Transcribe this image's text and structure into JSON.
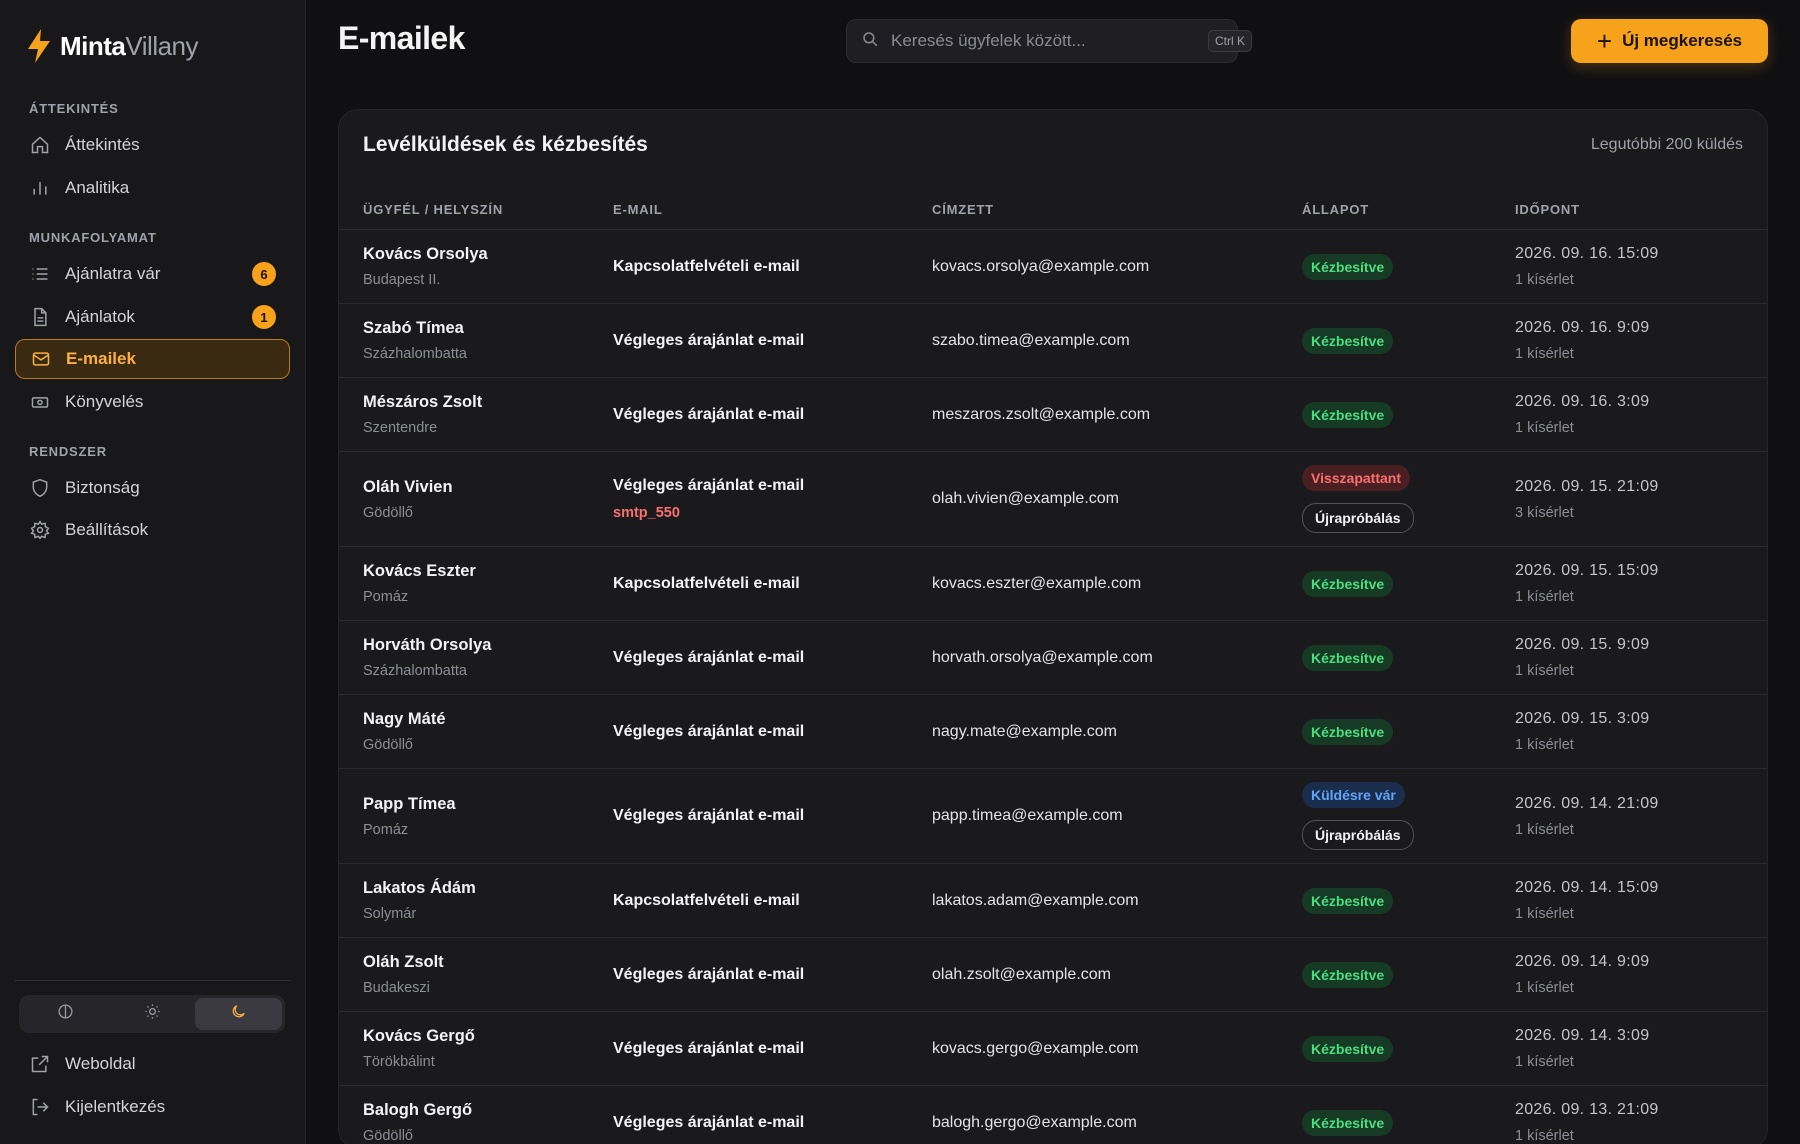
{
  "brand": {
    "part1": "Minta",
    "part2": "Villany",
    "accent": "#f7a21b"
  },
  "sidebar": {
    "sections": [
      {
        "label": "ÁTTEKINTÉS"
      },
      {
        "label": "MUNKAFOLYAMAT"
      },
      {
        "label": "RENDSZER"
      }
    ],
    "items": [
      {
        "label": "Áttekintés",
        "icon": "home-icon"
      },
      {
        "label": "Analitika",
        "icon": "bar-chart-icon"
      },
      {
        "label": "Ajánlatra vár",
        "icon": "list-icon",
        "count": "6"
      },
      {
        "label": "Ajánlatok",
        "icon": "document-icon",
        "count": "1"
      },
      {
        "label": "E-mailek",
        "icon": "mail-icon",
        "active": true
      },
      {
        "label": "Könyvelés",
        "icon": "banknote-icon"
      },
      {
        "label": "Biztonság",
        "icon": "shield-icon"
      },
      {
        "label": "Beállítások",
        "icon": "gear-icon"
      }
    ],
    "theme_options": [
      "contrast-icon",
      "sun-icon",
      "moon-icon"
    ],
    "theme_active": "moon-icon",
    "footer": [
      {
        "label": "Weboldal",
        "icon": "external-link-icon"
      },
      {
        "label": "Kijelentkezés",
        "icon": "logout-icon"
      }
    ]
  },
  "header": {
    "title": "E-mailek",
    "search_placeholder": "Keresés ügyfelek között...",
    "search_shortcut": "Ctrl K",
    "new_button": "Új megkeresés"
  },
  "card": {
    "title": "Levélküldések és kézbesítés",
    "meta": "Legutóbbi 200 küldés",
    "columns": [
      "ÜGYFÉL / HELYSZÍN",
      "E-MAIL",
      "CÍMZETT",
      "ÁLLAPOT",
      "IDŐPONT"
    ],
    "retry_label": "Újrapróbálás",
    "rows": [
      {
        "name": "Kovács Orsolya",
        "place": "Budapest II.",
        "subject": "Kapcsolatfelvételi e-mail",
        "recipient": "kovacs.orsolya@example.com",
        "status": "Kézbesítve",
        "status_type": "ok",
        "date": "2026. 09. 16. 15:09",
        "tries": "1 kísérlet"
      },
      {
        "name": "Szabó Tímea",
        "place": "Százhalombatta",
        "subject": "Végleges árajánlat e-mail",
        "recipient": "szabo.timea@example.com",
        "status": "Kézbesítve",
        "status_type": "ok",
        "date": "2026. 09. 16. 9:09",
        "tries": "1 kísérlet"
      },
      {
        "name": "Mészáros Zsolt",
        "place": "Szentendre",
        "subject": "Végleges árajánlat e-mail",
        "recipient": "meszaros.zsolt@example.com",
        "status": "Kézbesítve",
        "status_type": "ok",
        "date": "2026. 09. 16. 3:09",
        "tries": "1 kísérlet"
      },
      {
        "name": "Oláh Vivien",
        "place": "Gödöllő",
        "subject": "Végleges árajánlat e-mail",
        "error": "smtp_550",
        "recipient": "olah.vivien@example.com",
        "status": "Visszapattant",
        "status_type": "bounce",
        "retry": true,
        "date": "2026. 09. 15. 21:09",
        "tries": "3 kísérlet"
      },
      {
        "name": "Kovács Eszter",
        "place": "Pomáz",
        "subject": "Kapcsolatfelvételi e-mail",
        "recipient": "kovacs.eszter@example.com",
        "status": "Kézbesítve",
        "status_type": "ok",
        "date": "2026. 09. 15. 15:09",
        "tries": "1 kísérlet"
      },
      {
        "name": "Horváth Orsolya",
        "place": "Százhalombatta",
        "subject": "Végleges árajánlat e-mail",
        "recipient": "horvath.orsolya@example.com",
        "status": "Kézbesítve",
        "status_type": "ok",
        "date": "2026. 09. 15. 9:09",
        "tries": "1 kísérlet"
      },
      {
        "name": "Nagy Máté",
        "place": "Gödöllő",
        "subject": "Végleges árajánlat e-mail",
        "recipient": "nagy.mate@example.com",
        "status": "Kézbesítve",
        "status_type": "ok",
        "date": "2026. 09. 15. 3:09",
        "tries": "1 kísérlet"
      },
      {
        "name": "Papp Tímea",
        "place": "Pomáz",
        "subject": "Végleges árajánlat e-mail",
        "recipient": "papp.timea@example.com",
        "status": "Küldésre vár",
        "status_type": "wait",
        "retry": true,
        "date": "2026. 09. 14. 21:09",
        "tries": "1 kísérlet"
      },
      {
        "name": "Lakatos Ádám",
        "place": "Solymár",
        "subject": "Kapcsolatfelvételi e-mail",
        "recipient": "lakatos.adam@example.com",
        "status": "Kézbesítve",
        "status_type": "ok",
        "date": "2026. 09. 14. 15:09",
        "tries": "1 kísérlet"
      },
      {
        "name": "Oláh Zsolt",
        "place": "Budakeszi",
        "subject": "Végleges árajánlat e-mail",
        "recipient": "olah.zsolt@example.com",
        "status": "Kézbesítve",
        "status_type": "ok",
        "date": "2026. 09. 14. 9:09",
        "tries": "1 kísérlet"
      },
      {
        "name": "Kovács Gergő",
        "place": "Törökbálint",
        "subject": "Végleges árajánlat e-mail",
        "recipient": "kovacs.gergo@example.com",
        "status": "Kézbesítve",
        "status_type": "ok",
        "date": "2026. 09. 14. 3:09",
        "tries": "1 kísérlet"
      },
      {
        "name": "Balogh Gergő",
        "place": "Gödöllő",
        "subject": "Végleges árajánlat e-mail",
        "recipient": "balogh.gergo@example.com",
        "status": "Kézbesítve",
        "status_type": "ok",
        "date": "2026. 09. 13. 21:09",
        "tries": "1 kísérlet"
      }
    ]
  }
}
